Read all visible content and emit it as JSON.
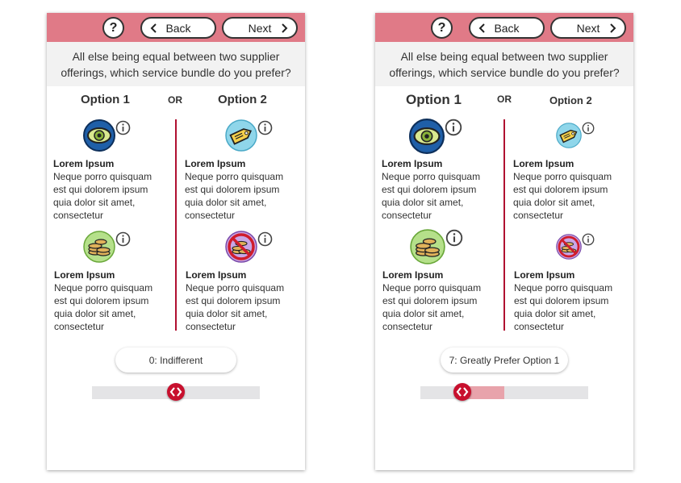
{
  "panels": [
    {
      "help_label": "?",
      "back_label": "Back",
      "next_label": "Next",
      "question": "All else being equal between two supplier offerings, which service bundle do you prefer?",
      "option1_title": "Option 1",
      "or_label": "OR",
      "option2_title": "Option 2",
      "features": [
        {
          "icon": "eye-icon",
          "title": "Lorem Ipsum",
          "desc": "Neque porro quisquam est qui dolorem ipsum quia dolor sit amet, consectetur"
        },
        {
          "icon": "price-tag-icon",
          "title": "Lorem Ipsum",
          "desc": "Neque porro quisquam est qui dolorem ipsum quia dolor sit amet, consectetur"
        },
        {
          "icon": "coins-icon",
          "title": "Lorem Ipsum",
          "desc": "Neque porro quisquam est qui dolorem ipsum quia dolor sit amet, consectetur"
        },
        {
          "icon": "no-coins-icon",
          "title": "Lorem Ipsum",
          "desc": "Neque porro quisquam est qui dolorem ipsum quia dolor sit amet, consectetur"
        }
      ],
      "preference_label": "0: Indifferent",
      "slider": {
        "fill_fraction": 0.0
      }
    },
    {
      "help_label": "?",
      "back_label": "Back",
      "next_label": "Next",
      "question": "All else being equal between two supplier offerings, which service bundle do you prefer?",
      "option1_title": "Option 1",
      "or_label": "OR",
      "option2_title": "Option 2",
      "features": [
        {
          "icon": "eye-icon",
          "title": "Lorem Ipsum",
          "desc": "Neque porro quisquam est qui dolorem ipsum quia dolor sit amet, consectetur"
        },
        {
          "icon": "price-tag-icon",
          "title": "Lorem Ipsum",
          "desc": "Neque porro quisquam est qui dolorem ipsum quia dolor sit amet, consectetur"
        },
        {
          "icon": "coins-icon",
          "title": "Lorem Ipsum",
          "desc": "Neque porro quisquam est qui dolorem ipsum quia dolor sit amet, consectetur"
        },
        {
          "icon": "no-coins-icon",
          "title": "Lorem Ipsum",
          "desc": "Neque porro quisquam est qui dolorem ipsum quia dolor sit amet, consectetur"
        }
      ],
      "preference_label": "7: Greatly Prefer Option 1",
      "slider": {
        "fill_fraction": 0.5
      }
    }
  ],
  "colors": {
    "header_bar": "#e07a87",
    "divider": "#b01030",
    "slider_thumb": "#c8102e",
    "slider_fill": "#e8a3ab",
    "slider_track": "#e4e4e6"
  }
}
